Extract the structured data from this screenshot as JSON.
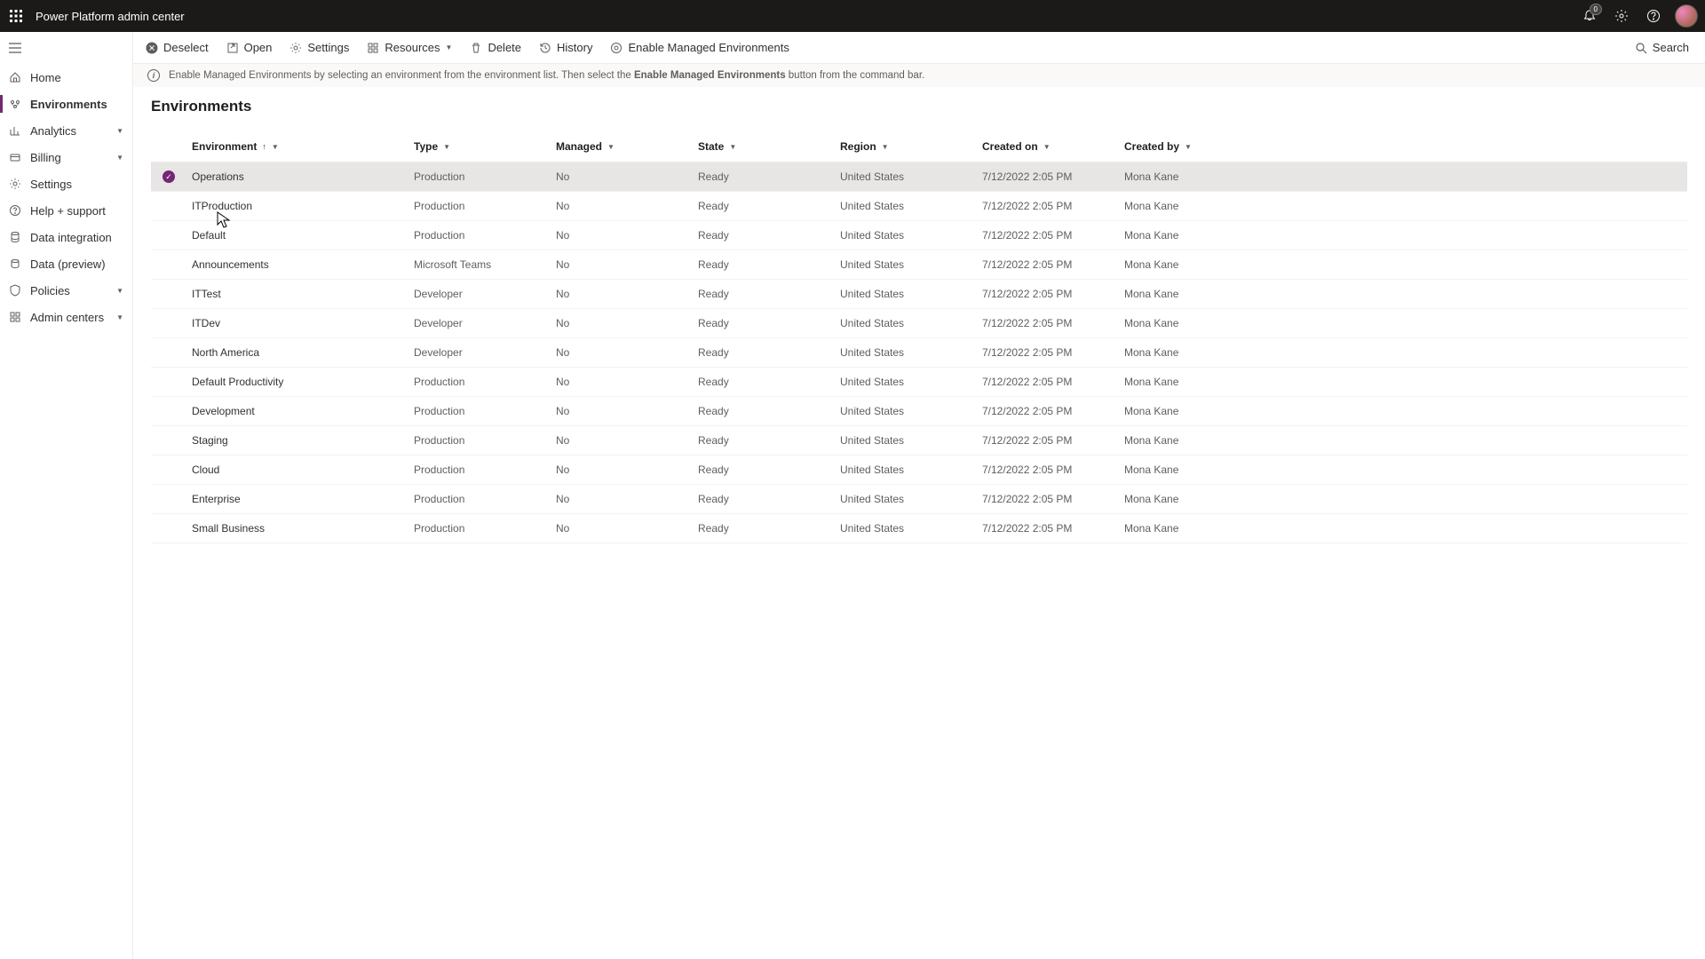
{
  "header": {
    "title": "Power Platform admin center",
    "notification_count": "0"
  },
  "sidebar": {
    "items": [
      {
        "label": "Home",
        "icon": "home-icon"
      },
      {
        "label": "Environments",
        "icon": "environments-icon"
      },
      {
        "label": "Analytics",
        "icon": "analytics-icon",
        "expandable": true
      },
      {
        "label": "Billing",
        "icon": "billing-icon",
        "expandable": true
      },
      {
        "label": "Settings",
        "icon": "settings-icon"
      },
      {
        "label": "Help + support",
        "icon": "help-icon"
      },
      {
        "label": "Data integration",
        "icon": "data-integration-icon"
      },
      {
        "label": "Data (preview)",
        "icon": "data-preview-icon"
      },
      {
        "label": "Policies",
        "icon": "policies-icon",
        "expandable": true
      },
      {
        "label": "Admin centers",
        "icon": "admin-centers-icon",
        "expandable": true
      }
    ]
  },
  "commands": {
    "deselect": "Deselect",
    "open": "Open",
    "settings": "Settings",
    "resources": "Resources",
    "delete": "Delete",
    "history": "History",
    "enable_managed": "Enable Managed Environments",
    "search": "Search"
  },
  "banner": {
    "prefix": "Enable Managed Environments by selecting an environment from the environment list. Then select the ",
    "bold": "Enable Managed Environments",
    "suffix": " button from the command bar."
  },
  "page": {
    "title": "Environments"
  },
  "columns": {
    "environment": "Environment",
    "type": "Type",
    "managed": "Managed",
    "state": "State",
    "region": "Region",
    "created_on": "Created on",
    "created_by": "Created by"
  },
  "rows": [
    {
      "name": "Operations",
      "type": "Production",
      "managed": "No",
      "state": "Ready",
      "region": "United States",
      "created_on": "7/12/2022 2:05 PM",
      "created_by": "Mona Kane",
      "selected": true
    },
    {
      "name": "ITProduction",
      "type": "Production",
      "managed": "No",
      "state": "Ready",
      "region": "United States",
      "created_on": "7/12/2022 2:05 PM",
      "created_by": "Mona Kane"
    },
    {
      "name": "Default",
      "type": "Production",
      "managed": "No",
      "state": "Ready",
      "region": "United States",
      "created_on": "7/12/2022 2:05 PM",
      "created_by": "Mona Kane"
    },
    {
      "name": "Announcements",
      "type": "Microsoft Teams",
      "managed": "No",
      "state": "Ready",
      "region": "United States",
      "created_on": "7/12/2022 2:05 PM",
      "created_by": "Mona Kane"
    },
    {
      "name": "ITTest",
      "type": "Developer",
      "managed": "No",
      "state": "Ready",
      "region": "United States",
      "created_on": "7/12/2022 2:05 PM",
      "created_by": "Mona Kane"
    },
    {
      "name": "ITDev",
      "type": "Developer",
      "managed": "No",
      "state": "Ready",
      "region": "United States",
      "created_on": "7/12/2022 2:05 PM",
      "created_by": "Mona Kane"
    },
    {
      "name": "North America",
      "type": "Developer",
      "managed": "No",
      "state": "Ready",
      "region": "United States",
      "created_on": "7/12/2022 2:05 PM",
      "created_by": "Mona Kane"
    },
    {
      "name": "Default Productivity",
      "type": "Production",
      "managed": "No",
      "state": "Ready",
      "region": "United States",
      "created_on": "7/12/2022 2:05 PM",
      "created_by": "Mona Kane"
    },
    {
      "name": "Development",
      "type": "Production",
      "managed": "No",
      "state": "Ready",
      "region": "United States",
      "created_on": "7/12/2022 2:05 PM",
      "created_by": "Mona Kane"
    },
    {
      "name": "Staging",
      "type": "Production",
      "managed": "No",
      "state": "Ready",
      "region": "United States",
      "created_on": "7/12/2022 2:05 PM",
      "created_by": "Mona Kane"
    },
    {
      "name": "Cloud",
      "type": "Production",
      "managed": "No",
      "state": "Ready",
      "region": "United States",
      "created_on": "7/12/2022 2:05 PM",
      "created_by": "Mona Kane"
    },
    {
      "name": "Enterprise",
      "type": "Production",
      "managed": "No",
      "state": "Ready",
      "region": "United States",
      "created_on": "7/12/2022 2:05 PM",
      "created_by": "Mona Kane"
    },
    {
      "name": "Small Business",
      "type": "Production",
      "managed": "No",
      "state": "Ready",
      "region": "United States",
      "created_on": "7/12/2022 2:05 PM",
      "created_by": "Mona Kane"
    }
  ]
}
